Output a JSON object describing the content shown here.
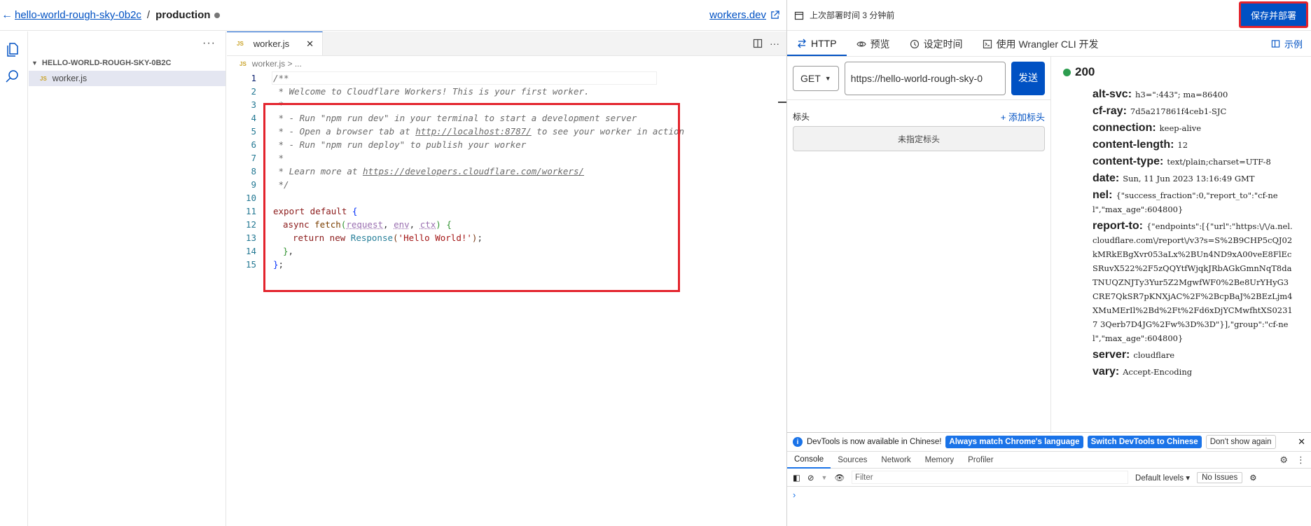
{
  "topbar": {
    "back_name": "hello-world-rough-sky-0b2c",
    "separator": "/",
    "environment": "production",
    "workers_link": "workers.dev",
    "deploy_info": "上次部署时间 3 分钟前",
    "save_button": "保存并部署"
  },
  "explorer": {
    "more": "···",
    "folder": "HELLO-WORLD-ROUGH-SKY-0B2C",
    "file_badge": "JS",
    "file": "worker.js"
  },
  "editor": {
    "tab_badge": "JS",
    "tab_label": "worker.js",
    "tab_close": "✕",
    "breadcrumb": "worker.js > ...",
    "code_lines": [
      {
        "n": "1",
        "text": "/**"
      },
      {
        "n": "2",
        "text": " * Welcome to Cloudflare Workers! This is your first worker."
      },
      {
        "n": "3",
        "text": " *"
      },
      {
        "n": "4",
        "text": " * - Run \"npm run dev\" in your terminal to start a development server"
      },
      {
        "n": "5",
        "pre": " * - Open a browser tab at ",
        "link": "http://localhost:8787/",
        "post": " to see your worker in action"
      },
      {
        "n": "6",
        "text": " * - Run \"npm run deploy\" to publish your worker"
      },
      {
        "n": "7",
        "text": " *"
      },
      {
        "n": "8",
        "pre": " * Learn more at ",
        "link": "https://developers.cloudflare.com/workers/",
        "post": ""
      },
      {
        "n": "9",
        "text": " */"
      },
      {
        "n": "10",
        "text": ""
      },
      {
        "n": "11",
        "export": "export",
        "default": "default",
        "brace": "{"
      },
      {
        "n": "12",
        "async": "async",
        "fetch": "fetch",
        "params": [
          "request",
          "env",
          "ctx"
        ],
        "brace": "{"
      },
      {
        "n": "13",
        "return": "return",
        "new": "new",
        "cls": "Response",
        "str": "'Hello World!'"
      },
      {
        "n": "14",
        "text": "},"
      },
      {
        "n": "15",
        "text": "};"
      }
    ]
  },
  "right_panel": {
    "tabs": [
      "HTTP",
      "预览",
      "设定时间",
      "使用 Wrangler CLI 开发"
    ],
    "examples": "示例",
    "method": "GET",
    "url": "https://hello-world-rough-sky-0",
    "send": "发送",
    "headers_label": "标头",
    "add_header": "+ 添加标头",
    "no_headers": "未指定标头",
    "status": "200",
    "response_headers": [
      {
        "k": "alt-svc:",
        "v": "h3=\":443\"; ma=86400"
      },
      {
        "k": "cf-ray:",
        "v": "7d5a217861f4ceb1-SJC"
      },
      {
        "k": "connection:",
        "v": "keep-alive"
      },
      {
        "k": "content-length:",
        "v": "12"
      },
      {
        "k": "content-type:",
        "v": "text/plain;charset=UTF-8"
      },
      {
        "k": "date:",
        "v": "Sun, 11 Jun 2023 13:16:49 GMT"
      },
      {
        "k": "nel:",
        "v": "{\"success_fraction\":0,\"report_to\":\"cf-nel\",\"max_age\":604800}"
      },
      {
        "k": "report-to:",
        "v": "{\"endpoints\":[{\"url\":\"https:\\/\\/a.nel.cloudflare.com\\/report\\/v3?s=S%2B9CHP5cQJ02kMRkEBgXvr053aLx%2BUn4ND9xA00veE8FlEcSRuvX522%2F5zQQYtfWjqkJRbAGkGmnNqT8daTNUQZNJTy3Yur5Z2MgwfWF0%2Be8UrYHyG3CRE7QkSR7pKNXjAC%2F%2BcpBaJ%2BEzLjm4XMuMErIl%2Bd%2Ft%2Fd6xDjYCMwfhtXS02317 3Qerb7D4JG%2Fw%3D%3D\"}],\"group\":\"cf-nel\",\"max_age\":604800}"
      },
      {
        "k": "server:",
        "v": "cloudflare"
      },
      {
        "k": "vary:",
        "v": "Accept-Encoding"
      }
    ]
  },
  "devtools": {
    "banner_text": "DevTools is now available in Chinese!",
    "btn_match": "Always match Chrome's language",
    "btn_switch": "Switch DevTools to Chinese",
    "btn_dont": "Don't show again",
    "close": "✕",
    "tabs": [
      "Console",
      "Sources",
      "Network",
      "Memory",
      "Profiler"
    ],
    "filter": "Filter",
    "levels": "Default levels ▾",
    "issues": "No Issues",
    "prompt": "›"
  },
  "colors": {
    "accent": "#0051c3",
    "highlight_border": "#e3232c",
    "status_ok": "#2d9d4f",
    "devtools_blue": "#1a73e8"
  }
}
